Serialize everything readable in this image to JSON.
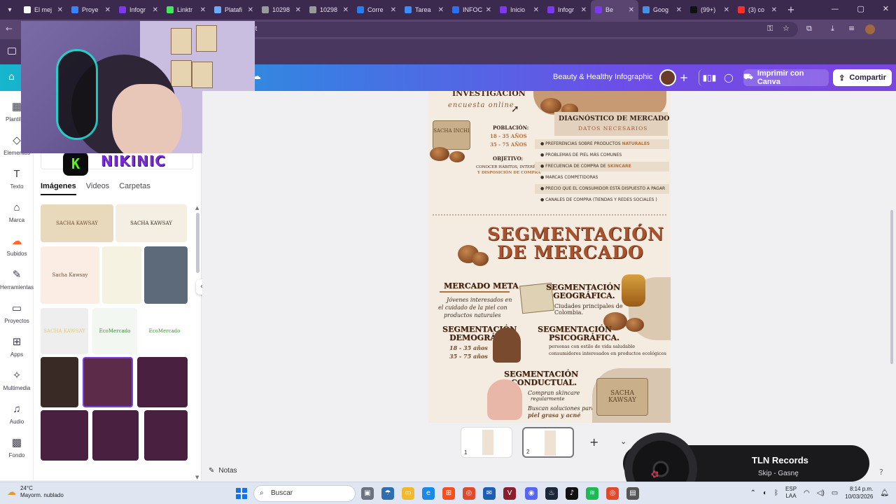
{
  "browser": {
    "tabs": [
      {
        "title": "El mej",
        "color": "#ffffff",
        "active": false
      },
      {
        "title": "Proye",
        "color": "#3b82f6",
        "active": false
      },
      {
        "title": "Infogr",
        "color": "#7c3aed",
        "active": false
      },
      {
        "title": "Linktr",
        "color": "#43e660",
        "active": false
      },
      {
        "title": "Platafi",
        "color": "#6ea8ff",
        "active": false
      },
      {
        "title": "10298",
        "color": "#9a9a9a",
        "active": false
      },
      {
        "title": "10298",
        "color": "#9a9a9a",
        "active": false
      },
      {
        "title": "Corre",
        "color": "#2b7de9",
        "active": false
      },
      {
        "title": "Tarea",
        "color": "#3d8bfd",
        "active": false
      },
      {
        "title": "INFOC",
        "color": "#2f6fed",
        "active": false
      },
      {
        "title": "Inicio",
        "color": "#7c3aed",
        "active": false
      },
      {
        "title": "Infogr",
        "color": "#7c3aed",
        "active": false
      },
      {
        "title": "Be",
        "color": "#7c3aed",
        "active": true
      },
      {
        "title": "Goog",
        "color": "#4a90e2",
        "active": false
      },
      {
        "title": "(99+)",
        "color": "#111111",
        "active": false
      },
      {
        "title": "(3) co",
        "color": "#ff2d2d",
        "active": false
      }
    ],
    "new_tab": "+",
    "address_fragment": "lit"
  },
  "canva": {
    "doc_title": "Beauty & Healthy Infographic",
    "print_label": "Imprimir con Canva",
    "share_label": "Compartir"
  },
  "rail": [
    {
      "label": "Plantillas",
      "icon": "template-icon",
      "glyph": "▦"
    },
    {
      "label": "Elementos",
      "icon": "elements-icon",
      "glyph": "◇"
    },
    {
      "label": "Texto",
      "icon": "text-icon",
      "glyph": "T"
    },
    {
      "label": "Marca",
      "icon": "brand-icon",
      "glyph": "⌂"
    },
    {
      "label": "Subidos",
      "icon": "upload-cloud-icon",
      "glyph": "☁"
    },
    {
      "label": "Herramientas",
      "icon": "tools-icon",
      "glyph": "✎"
    },
    {
      "label": "Proyectos",
      "icon": "folder-icon",
      "glyph": "▭"
    },
    {
      "label": "Apps",
      "icon": "apps-icon",
      "glyph": "⊞"
    },
    {
      "label": "Multimedia",
      "icon": "multimedia-icon",
      "glyph": "✧"
    },
    {
      "label": "Audio",
      "icon": "music-note-icon",
      "glyph": "♫"
    },
    {
      "label": "Fondo",
      "icon": "background-icon",
      "glyph": "▩"
    }
  ],
  "panel": {
    "tabs": [
      "Imágenes",
      "Videos",
      "Carpetas"
    ],
    "streamer_name": "NIKINIC",
    "kick_logo": "K"
  },
  "uploads": [
    {
      "name": "soap-bar-thumb",
      "text": "SACHA KAWSAY",
      "bg": "#e8d9bc",
      "fg": "#6a4c2b"
    },
    {
      "name": "logo-round-thumb",
      "text": "SACHA KAWSAY",
      "bg": "#f4efe2",
      "fg": "#3d2c1a"
    },
    {
      "name": "logo-circle-thumb",
      "text": "Sacha Kawsay",
      "bg": "#fbece4",
      "fg": "#6e4f3c"
    },
    {
      "name": "soap-pieces-thumb",
      "text": "",
      "bg": "#f6f2e2",
      "fg": "#000000"
    },
    {
      "name": "photo-thumb",
      "text": "",
      "bg": "#5d6a7a",
      "fg": "#000000"
    },
    {
      "name": "dark-logo-thumb",
      "text": "SACHA KAWSAY",
      "bg": "#eeeeee",
      "fg": "#e6c67b"
    },
    {
      "name": "ecomercado-thumb-1",
      "text": "EcoMercado",
      "bg": "#f2f7f1",
      "fg": "#3f8f3a"
    },
    {
      "name": "ecomercado-thumb-2",
      "text": "EcoMercado",
      "bg": "#ffffff",
      "fg": "#3f8f3a"
    },
    {
      "name": "selfie-thumb",
      "text": "",
      "bg": "#3a2a25",
      "fg": "#000000"
    },
    {
      "name": "catgirl-sticker-1",
      "text": "",
      "bg": "#5c2b4a",
      "fg": "#000000"
    },
    {
      "name": "catgirl-sticker-2",
      "text": "",
      "bg": "#4a2040",
      "fg": "#000000"
    },
    {
      "name": "catgirl-sticker-3",
      "text": "",
      "bg": "#4a2040",
      "fg": "#000000"
    },
    {
      "name": "catgirl-sticker-4",
      "text": "",
      "bg": "#4a2040",
      "fg": "#000000"
    },
    {
      "name": "catgirl-sticker-5",
      "text": "",
      "bg": "#4a2040",
      "fg": "#000000"
    }
  ],
  "infographic": {
    "top_investigacion": "INVESTIGACIÓN",
    "encuesta": "encuesta online",
    "soap_label": "SACHA INCHI",
    "poblacion_label": "POBLACIÓN:",
    "poblacion_1": "18 - 35 AÑOS",
    "poblacion_2": "35 - 75 AÑOS",
    "objetivo_label": "OBJETIVO:",
    "objetivo_1": "CONOCER HÁBITOS, INTERÉS",
    "objetivo_2": "Y DISPOSICIÓN DE COMPRA",
    "diag_title": "DIAGNÓSTICO DE MERCADO",
    "diag_sub": "DATOS NECESARIOS",
    "bullets": [
      {
        "text": "PREFERENCIAS SOBRE PRODUCTOS",
        "hl": "NATURALES"
      },
      {
        "text": "PROBLEMAS DE PIEL MÁS COMUNES",
        "hl": ""
      },
      {
        "text": "FRECUENCIA DE COMPRA DE",
        "hl": "SKINCARE"
      },
      {
        "text": "MARCAS COMPETIDORAS",
        "hl": ""
      },
      {
        "text": "PRECIO QUE EL CONSUMIDOR ESTÁ DISPUESTO A PAGAR",
        "hl": ""
      },
      {
        "text": "CANALES DE COMPRA (TIENDAS Y REDES SOCIALES )",
        "hl": ""
      }
    ],
    "seg_line1": "SEGMENTACIÓN",
    "seg_line2": "DE MERCADO",
    "meta_title": "MERCADO META",
    "meta_1": "Jóvenes interesados en",
    "meta_2": "el cuidado de la piel con",
    "meta_3": "productos naturales",
    "geo_title_1": "SEGMENTACIÓN",
    "geo_title_2": "GEOGRÁFICA.",
    "geo_1": "Ciudades principales de",
    "geo_2": "Colombia.",
    "demo_title_1": "SEGMENTACIÓN",
    "demo_title_2": "DEMOGRÁFICA.",
    "demo_1": "18 - 35 años",
    "demo_2": "35 - 75 años",
    "psico_title_1": "SEGMENTACIÓN",
    "psico_title_2": "PSICOGRÁFICA.",
    "psico_1": "personas con estilo de vida saludable",
    "psico_2": "consumidores interesados en productos ecológicos",
    "cond_title_1": "SEGMENTACIÓN",
    "cond_title_2": "CONDUCTUAL.",
    "cond_1": "Compran skincare",
    "cond_2": "regularmente",
    "cond_3": "Buscan soluciones para",
    "cond_4": "piel grasa y acné",
    "soap2_label": "SACHA KAWSAY"
  },
  "pages": [
    "1",
    "2"
  ],
  "notes_label": "Notas",
  "music": {
    "title": "TLN Records",
    "artist": "Skip - Gasnę"
  },
  "taskbar": {
    "temp": "24°C",
    "weather": "Mayorm. nublado",
    "search": "Buscar",
    "lang_1": "ESP",
    "lang_2": "LAA",
    "time": "8:14 p.m.",
    "date": "10/03/2026"
  }
}
